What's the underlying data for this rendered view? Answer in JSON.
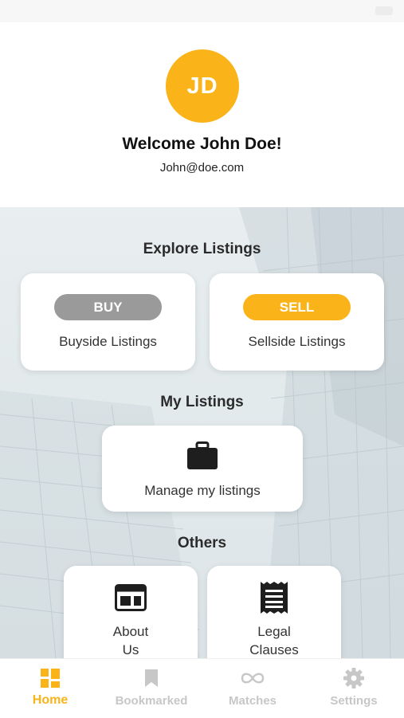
{
  "profile": {
    "initials": "JD",
    "welcome": "Welcome John Doe!",
    "email": "John@doe.com"
  },
  "explore": {
    "title": "Explore Listings",
    "buy_label": "BUY",
    "buy_caption": "Buyside Listings",
    "sell_label": "SELL",
    "sell_caption": "Sellside Listings"
  },
  "my_listings": {
    "title": "My Listings",
    "manage_caption": "Manage my listings",
    "icon": "briefcase-icon"
  },
  "others": {
    "title": "Others",
    "about_line1": "About",
    "about_line2": "Us",
    "legal_line1": "Legal",
    "legal_line2": "Clauses"
  },
  "tabs": [
    {
      "label": "Home",
      "icon": "home-grid-icon",
      "active": true
    },
    {
      "label": "Bookmarked",
      "icon": "bookmark-icon",
      "active": false
    },
    {
      "label": "Matches",
      "icon": "infinity-icon",
      "active": false
    },
    {
      "label": "Settings",
      "icon": "gear-icon",
      "active": false
    }
  ],
  "colors": {
    "accent": "#fbb31a",
    "buy_pill": "#9a9a9a",
    "inactive_tab": "#c7c7c7",
    "icon_dark": "#1e1e1e"
  }
}
